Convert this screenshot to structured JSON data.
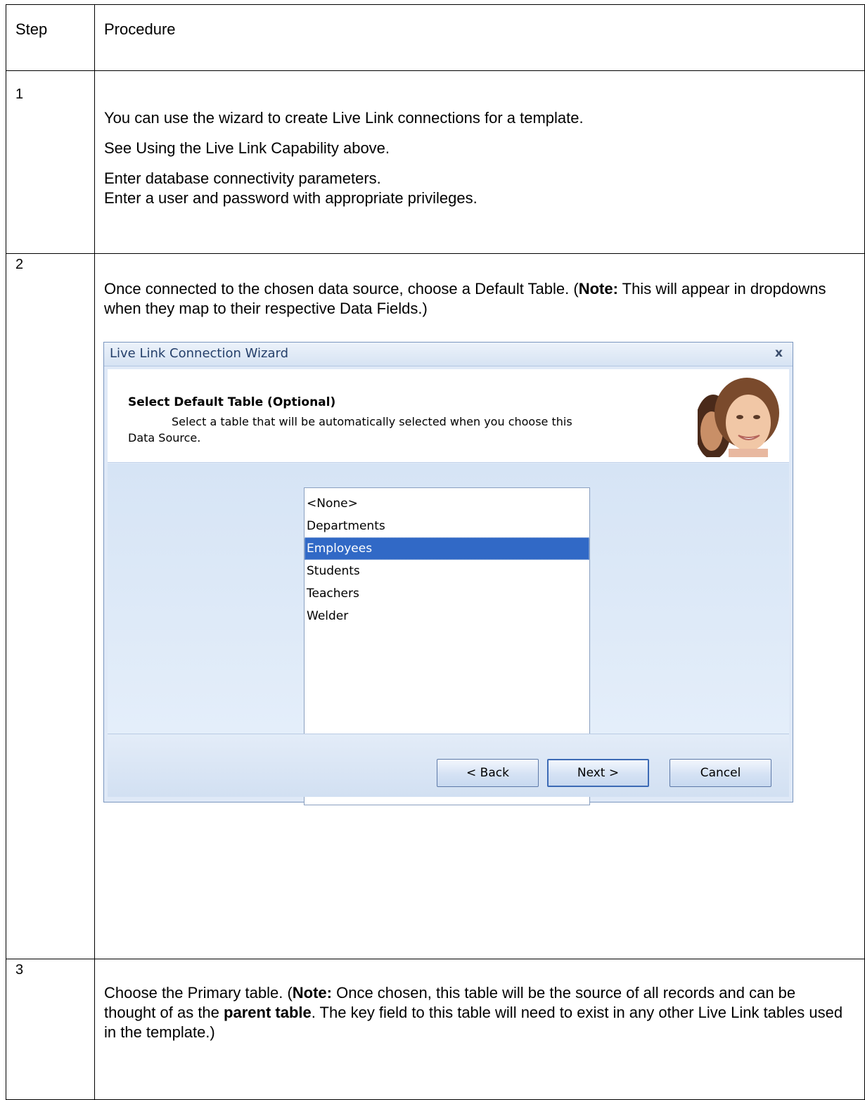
{
  "table": {
    "header": {
      "step": "Step",
      "procedure": "Procedure"
    },
    "rows": [
      {
        "step": "1",
        "paragraphs": [
          "You can use the wizard to create Live Link connections for a template.",
          "See Using the Live Link Capability above.",
          "Enter database connectivity parameters.",
          "Enter a user and password with appropriate privileges."
        ]
      },
      {
        "step": "2",
        "text_before": "Once connected to the chosen data source, choose a Default Table. (",
        "note_label": "Note:",
        "text_after": "  This will appear in dropdowns when they map to their respective Data Fields.)"
      },
      {
        "step": "3",
        "text_before": "Choose the Primary table. (",
        "note_label": "Note:",
        "text_mid": "  Once chosen, this table will be the source of all records and can be thought of as the ",
        "bold_term": "parent table",
        "text_after": ". The key field to this table will need to exist in any other Live Link tables used in the template.)"
      }
    ]
  },
  "wizard": {
    "title": "Live Link Connection Wizard",
    "close_glyph": "x",
    "heading": "Select Default Table (Optional)",
    "description_line1": "Select a table that will be automatically selected when you choose this",
    "description_line2": "Data Source.",
    "tables": [
      "<None>",
      "Departments",
      "Employees",
      "Students",
      "Teachers",
      "Welder"
    ],
    "selected_table": "Employees",
    "buttons": {
      "back": "< Back",
      "next": "Next >",
      "cancel": "Cancel"
    },
    "colors": {
      "selection": "#3169c6",
      "body": "#dfe9f7",
      "title_text": "#243f6a"
    }
  }
}
